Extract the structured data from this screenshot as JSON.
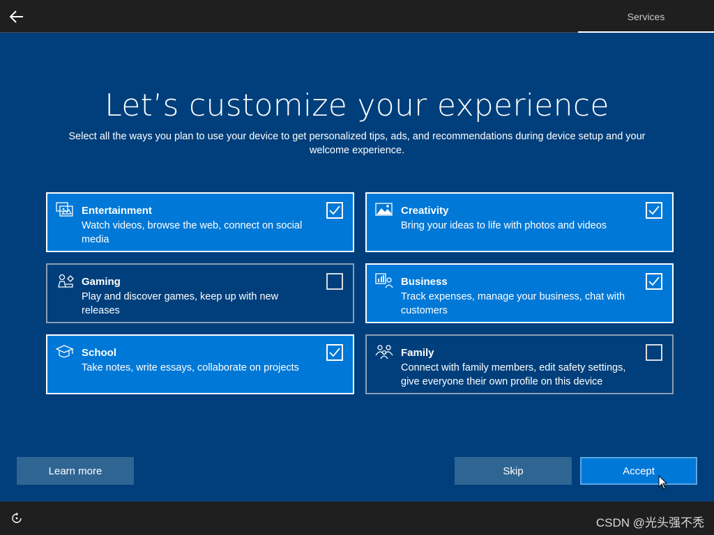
{
  "topbar": {
    "tab_label": "Services"
  },
  "heading": {
    "title": "Let’s customize your experience",
    "subtitle": "Select all the ways you plan to use your device to get personalized tips, ads, and recommendations during device setup and your welcome experience."
  },
  "options": [
    {
      "title": "Entertainment",
      "description": "Watch videos, browse the web, connect on social media",
      "checked": true,
      "icon": "entertainment-icon"
    },
    {
      "title": "Creativity",
      "description": "Bring your ideas to life with photos and videos",
      "checked": true,
      "icon": "creativity-icon"
    },
    {
      "title": "Gaming",
      "description": "Play and discover games, keep up with new releases",
      "checked": false,
      "icon": "gaming-icon"
    },
    {
      "title": "Business",
      "description": "Track expenses, manage your business, chat with customers",
      "checked": true,
      "icon": "business-icon"
    },
    {
      "title": "School",
      "description": "Take notes, write essays, collaborate on projects",
      "checked": true,
      "icon": "school-icon"
    },
    {
      "title": "Family",
      "description": "Connect with family members, edit safety settings, give everyone their own profile on this device",
      "checked": false,
      "icon": "family-icon"
    }
  ],
  "buttons": {
    "learn_more": "Learn more",
    "skip": "Skip",
    "accept": "Accept"
  },
  "watermark": "CSDN @光头强不秃",
  "colors": {
    "background": "#003f7b",
    "selected": "#0078d7",
    "bar": "#1f1f1f"
  }
}
